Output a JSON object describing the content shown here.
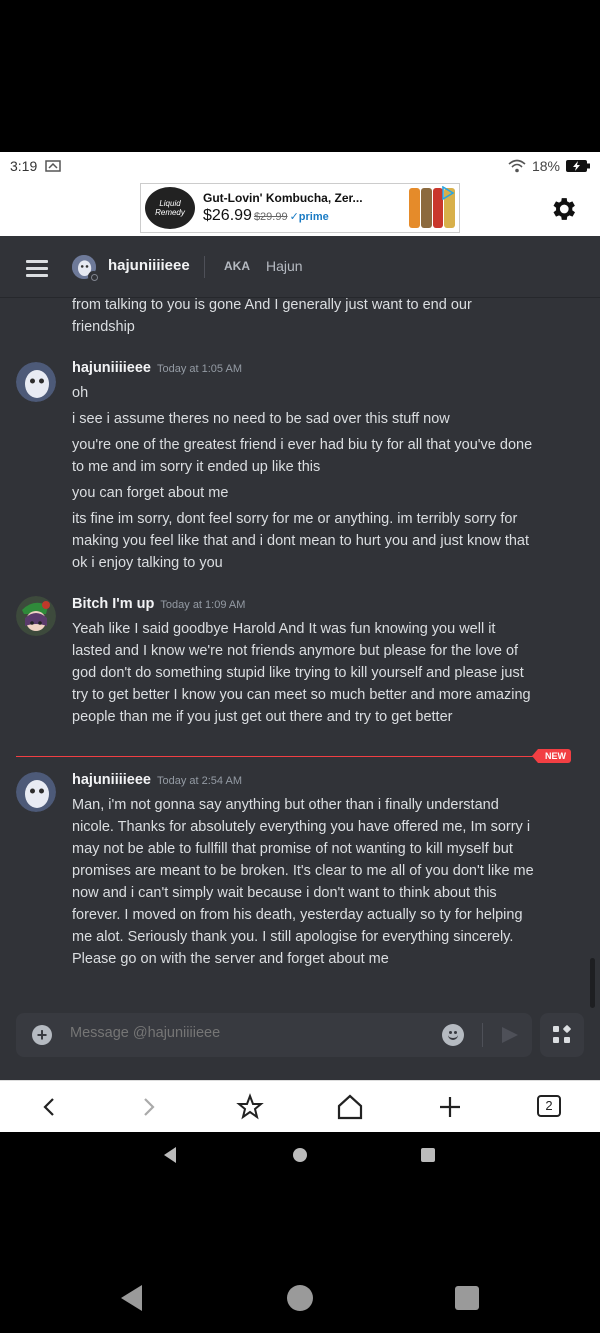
{
  "status_bar": {
    "time": "3:19",
    "battery": "18%"
  },
  "ad": {
    "brand": "Liquid Remedy",
    "title": "Gut-Lovin' Kombucha, Zer...",
    "price": "$26.99",
    "was_price": "$29.99",
    "prime": "✓prime"
  },
  "header": {
    "channel_name": "hajuniiiieee",
    "aka_label": "AKA",
    "nickname": "Hajun"
  },
  "continued_message": {
    "lines": [
      "from talking to you is gone And I generally just want to end our friendship"
    ]
  },
  "messages": [
    {
      "author": "hajuniiiieee",
      "timestamp": "Today at 1:05 AM",
      "lines": [
        "oh",
        "i see i assume theres no need to be sad over this stuff now",
        "you're one of the greatest friend i ever had biu ty for all that you've done to me and im sorry it ended up like this",
        "you can forget about me",
        "its fine im sorry, dont feel sorry for me or anything. im terribly sorry for making you feel like that and i dont mean to hurt you and just know that ok i enjoy talking to you"
      ]
    },
    {
      "author": "Bitch I'm up",
      "timestamp": "Today at 1:09 AM",
      "lines": [
        "Yeah like I said goodbye Harold And  It was fun knowing you well it lasted and I know we're not friends anymore but please for the love of god don't do something stupid like trying to kill yourself and please just try to get better I know you can meet so much better and more amazing people than me if you just get out there and try to get better"
      ]
    },
    {
      "author": "hajuniiiieee",
      "timestamp": "Today at 2:54 AM",
      "lines": [
        "Man, i'm not gonna say anything but other than i finally understand nicole. Thanks for absolutely everything you have offered me, Im sorry i may not be able to fullfill that promise of not wanting to kill myself but promises are meant to be broken. It's clear to me all of you don't like me now and i can't simply wait because i don't want to think about this forever. I moved on from his death, yesterday actually so ty for helping me alot. Seriously thank you. I still apologise for everything sincerely. Please go on with the server and forget about me"
      ]
    }
  ],
  "new_badge": "NEW",
  "composer": {
    "placeholder": "Message @hajuniiiieee"
  },
  "browser": {
    "tab_count": "2"
  }
}
